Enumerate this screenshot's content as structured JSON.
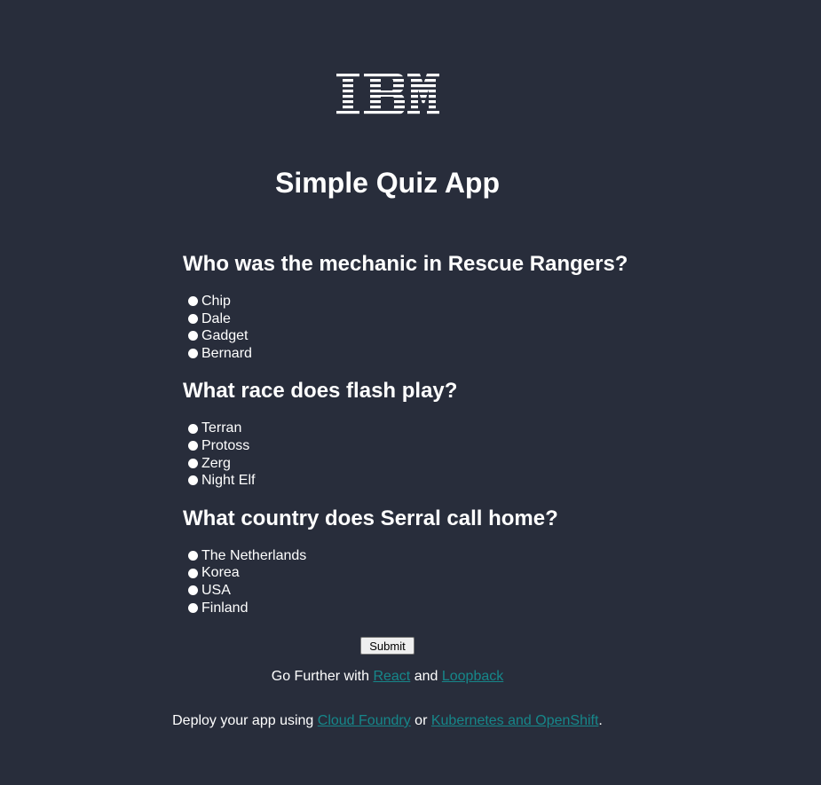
{
  "logo": {
    "text": "IBM",
    "color": "#ffffff"
  },
  "title": "Simple Quiz App",
  "questions": [
    {
      "text": "Who was the mechanic in Rescue Rangers?",
      "options": [
        "Chip",
        "Dale",
        "Gadget",
        "Bernard"
      ]
    },
    {
      "text": "What race does flash play?",
      "options": [
        "Terran",
        "Protoss",
        "Zerg",
        "Night Elf"
      ]
    },
    {
      "text": "What country does Serral call home?",
      "options": [
        "The Netherlands",
        "Korea",
        "USA",
        "Finland"
      ]
    }
  ],
  "submit_label": "Submit",
  "footer": {
    "line1": {
      "prefix": "Go Further with ",
      "link1": "React",
      "middle": " and ",
      "link2": "Loopback"
    },
    "line2": {
      "prefix": "Deploy your app using ",
      "link1": "Cloud Foundry",
      "middle": " or ",
      "link2": "Kubernetes and OpenShift",
      "suffix": "."
    }
  },
  "colors": {
    "background": "#282d3b",
    "text": "#ffffff",
    "link": "#16878a"
  }
}
